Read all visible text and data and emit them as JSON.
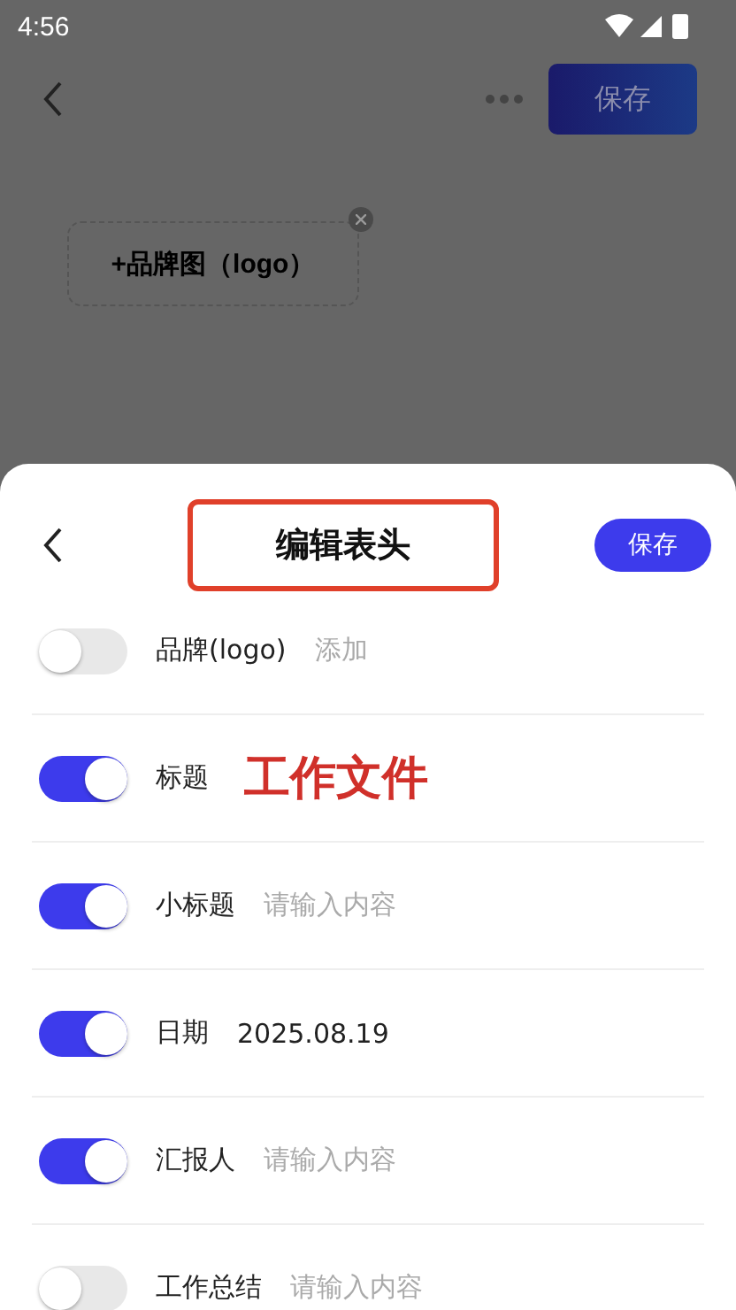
{
  "status_bar": {
    "time": "4:56"
  },
  "app_bar": {
    "save": "保存"
  },
  "page": {
    "logo_button": "+品牌图（logo）"
  },
  "sheet": {
    "title": "编辑表头",
    "title_highlighted": true,
    "save": "保存",
    "rows": [
      {
        "label": "品牌(logo)",
        "kind": "hint",
        "text": "添加",
        "on": false
      },
      {
        "label": "标题",
        "kind": "title",
        "text": "工作文件",
        "on": true
      },
      {
        "label": "小标题",
        "kind": "hint",
        "text": "请输入内容",
        "on": true
      },
      {
        "label": "日期",
        "kind": "value",
        "text": "2025.08.19",
        "on": true
      },
      {
        "label": "汇报人",
        "kind": "hint",
        "text": "请输入内容",
        "on": true
      },
      {
        "label": "工作总结",
        "kind": "hint",
        "text": "请输入内容",
        "on": false
      }
    ]
  }
}
